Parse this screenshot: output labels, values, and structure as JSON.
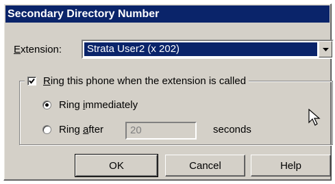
{
  "window": {
    "title": "Secondary Directory Number"
  },
  "extension": {
    "label_prefix": "",
    "label_accel": "E",
    "label_rest": "xtension:",
    "selected_value": "Strata User2 (x 202)"
  },
  "ring_group": {
    "checkbox_checked": true,
    "label_accel": "R",
    "label_rest": "ing this phone when the extension is called",
    "option_immediately": {
      "prefix": "Ring ",
      "accel": "i",
      "rest": "mmediately",
      "selected": true
    },
    "option_after": {
      "prefix": "Ring ",
      "accel": "a",
      "rest": "fter",
      "selected": false
    },
    "after_value": "20",
    "seconds_label": "seconds"
  },
  "buttons": {
    "ok": "OK",
    "cancel": "Cancel",
    "help": "Help"
  },
  "icons": {
    "dropdown": "chevron-down-icon",
    "cursor": "mouse-pointer-icon",
    "check": "checkmark-icon"
  }
}
